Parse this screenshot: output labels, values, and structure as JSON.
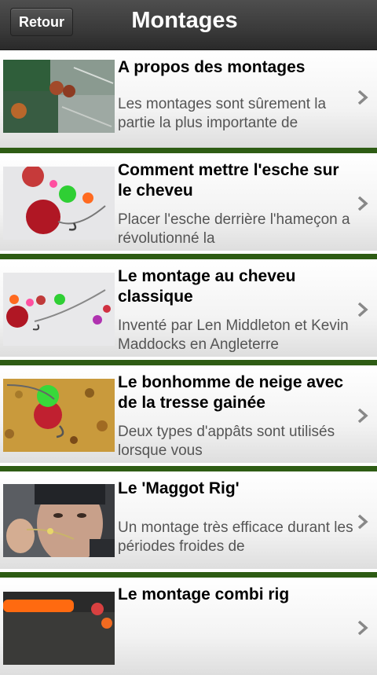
{
  "header": {
    "back_label": "Retour",
    "title": "Montages"
  },
  "items": [
    {
      "title": "A propos des montages",
      "desc": "Les montages sont sûrement la partie la plus importante de"
    },
    {
      "title": "Comment mettre l'esche sur le cheveu",
      "desc": "Placer l'esche derrière l'hameçon a révolutionné la"
    },
    {
      "title": "Le montage au cheveu classique",
      "desc": "Inventé par Len Middleton et Kevin Maddocks en Angleterre"
    },
    {
      "title": "Le bonhomme de neige avec de la tresse gainée",
      "desc": "Deux types d'appâts sont utilisés lorsque vous"
    },
    {
      "title": "Le 'Maggot Rig'",
      "desc": "Un montage très efficace durant les périodes froides de"
    },
    {
      "title": "Le montage combi rig",
      "desc": ""
    }
  ],
  "colors": {
    "separator": "#2e5c14",
    "header_bg": "#3a3a3a"
  }
}
